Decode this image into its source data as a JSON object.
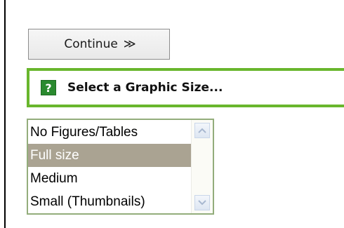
{
  "continue_button": {
    "label": "Continue",
    "arrow": "≫"
  },
  "prompt": {
    "icon_label": "?",
    "text": "Select a Graphic Size..."
  },
  "graphic_size_list": {
    "options": [
      "No Figures/Tables",
      "Full size",
      "Medium",
      "Small (Thumbnails)"
    ],
    "selected": "Full size"
  },
  "colors": {
    "prompt_border": "#69b62d",
    "help_icon": "#2a8a2f",
    "selected_row": "#aaa392",
    "list_border": "#93ad7b"
  },
  "icons": {
    "help": "question-mark-icon",
    "scroll_up": "chevron-up-icon",
    "scroll_down": "chevron-down-icon"
  }
}
